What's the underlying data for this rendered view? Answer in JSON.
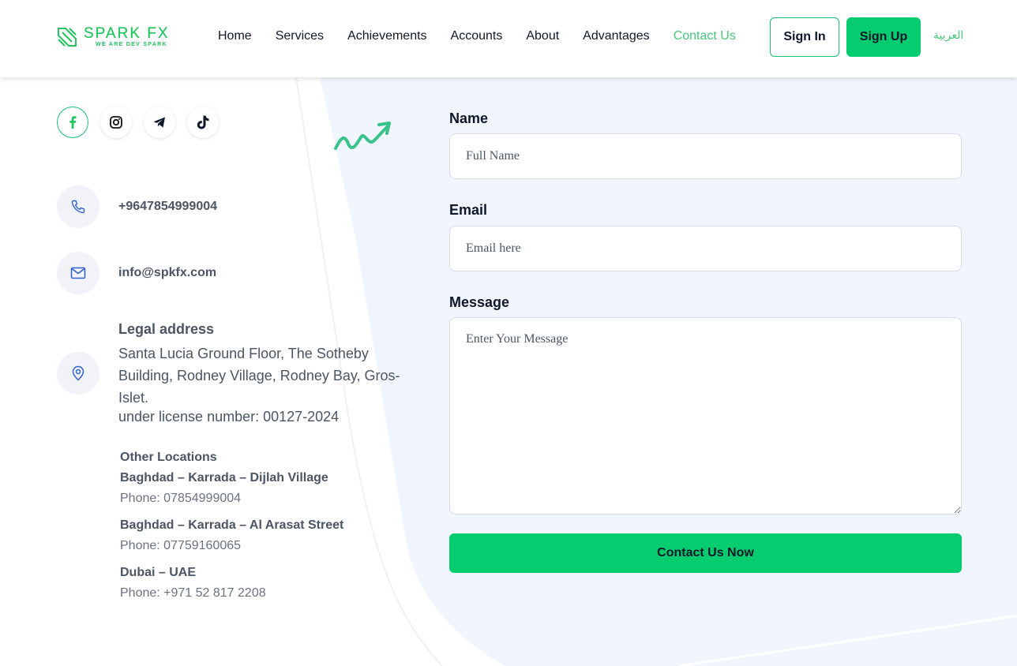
{
  "brand": {
    "name": "SPARK FX",
    "tagline": "WE ARE DEV SPARK",
    "accent": "#04cc6f"
  },
  "nav": {
    "items": [
      {
        "label": "Home"
      },
      {
        "label": "Services"
      },
      {
        "label": "Achievements"
      },
      {
        "label": "Accounts"
      },
      {
        "label": "About"
      },
      {
        "label": "Advantages"
      },
      {
        "label": "Contact Us",
        "active": true
      }
    ],
    "sign_in": "Sign In",
    "sign_up": "Sign Up",
    "language": "العربية"
  },
  "social": [
    "facebook-icon",
    "instagram-icon",
    "telegram-icon",
    "tiktok-icon"
  ],
  "contact": {
    "phone": "+9647854999004",
    "email": "info@spkfx.com",
    "legal_title": "Legal address",
    "legal_address": "Santa Lucia Ground Floor, The Sotheby Building, Rodney Village, Rodney Bay, Gros-Islet.",
    "license": "under license number: 00127-2024",
    "other_title": "Other Locations",
    "locations": [
      {
        "name": "Baghdad – Karrada – Dijlah Village",
        "phone": "Phone: 07854999004"
      },
      {
        "name": "Baghdad – Karrada – Al Arasat Street",
        "phone": "Phone: 07759160065"
      },
      {
        "name": "Dubai – UAE",
        "phone": "Phone: +971 52 817 2208"
      }
    ]
  },
  "form": {
    "name_label": "Name",
    "name_placeholder": "Full Name",
    "email_label": "Email",
    "email_placeholder": "Email here",
    "message_label": "Message",
    "message_placeholder": "Enter Your Message",
    "submit": "Contact Us Now"
  }
}
